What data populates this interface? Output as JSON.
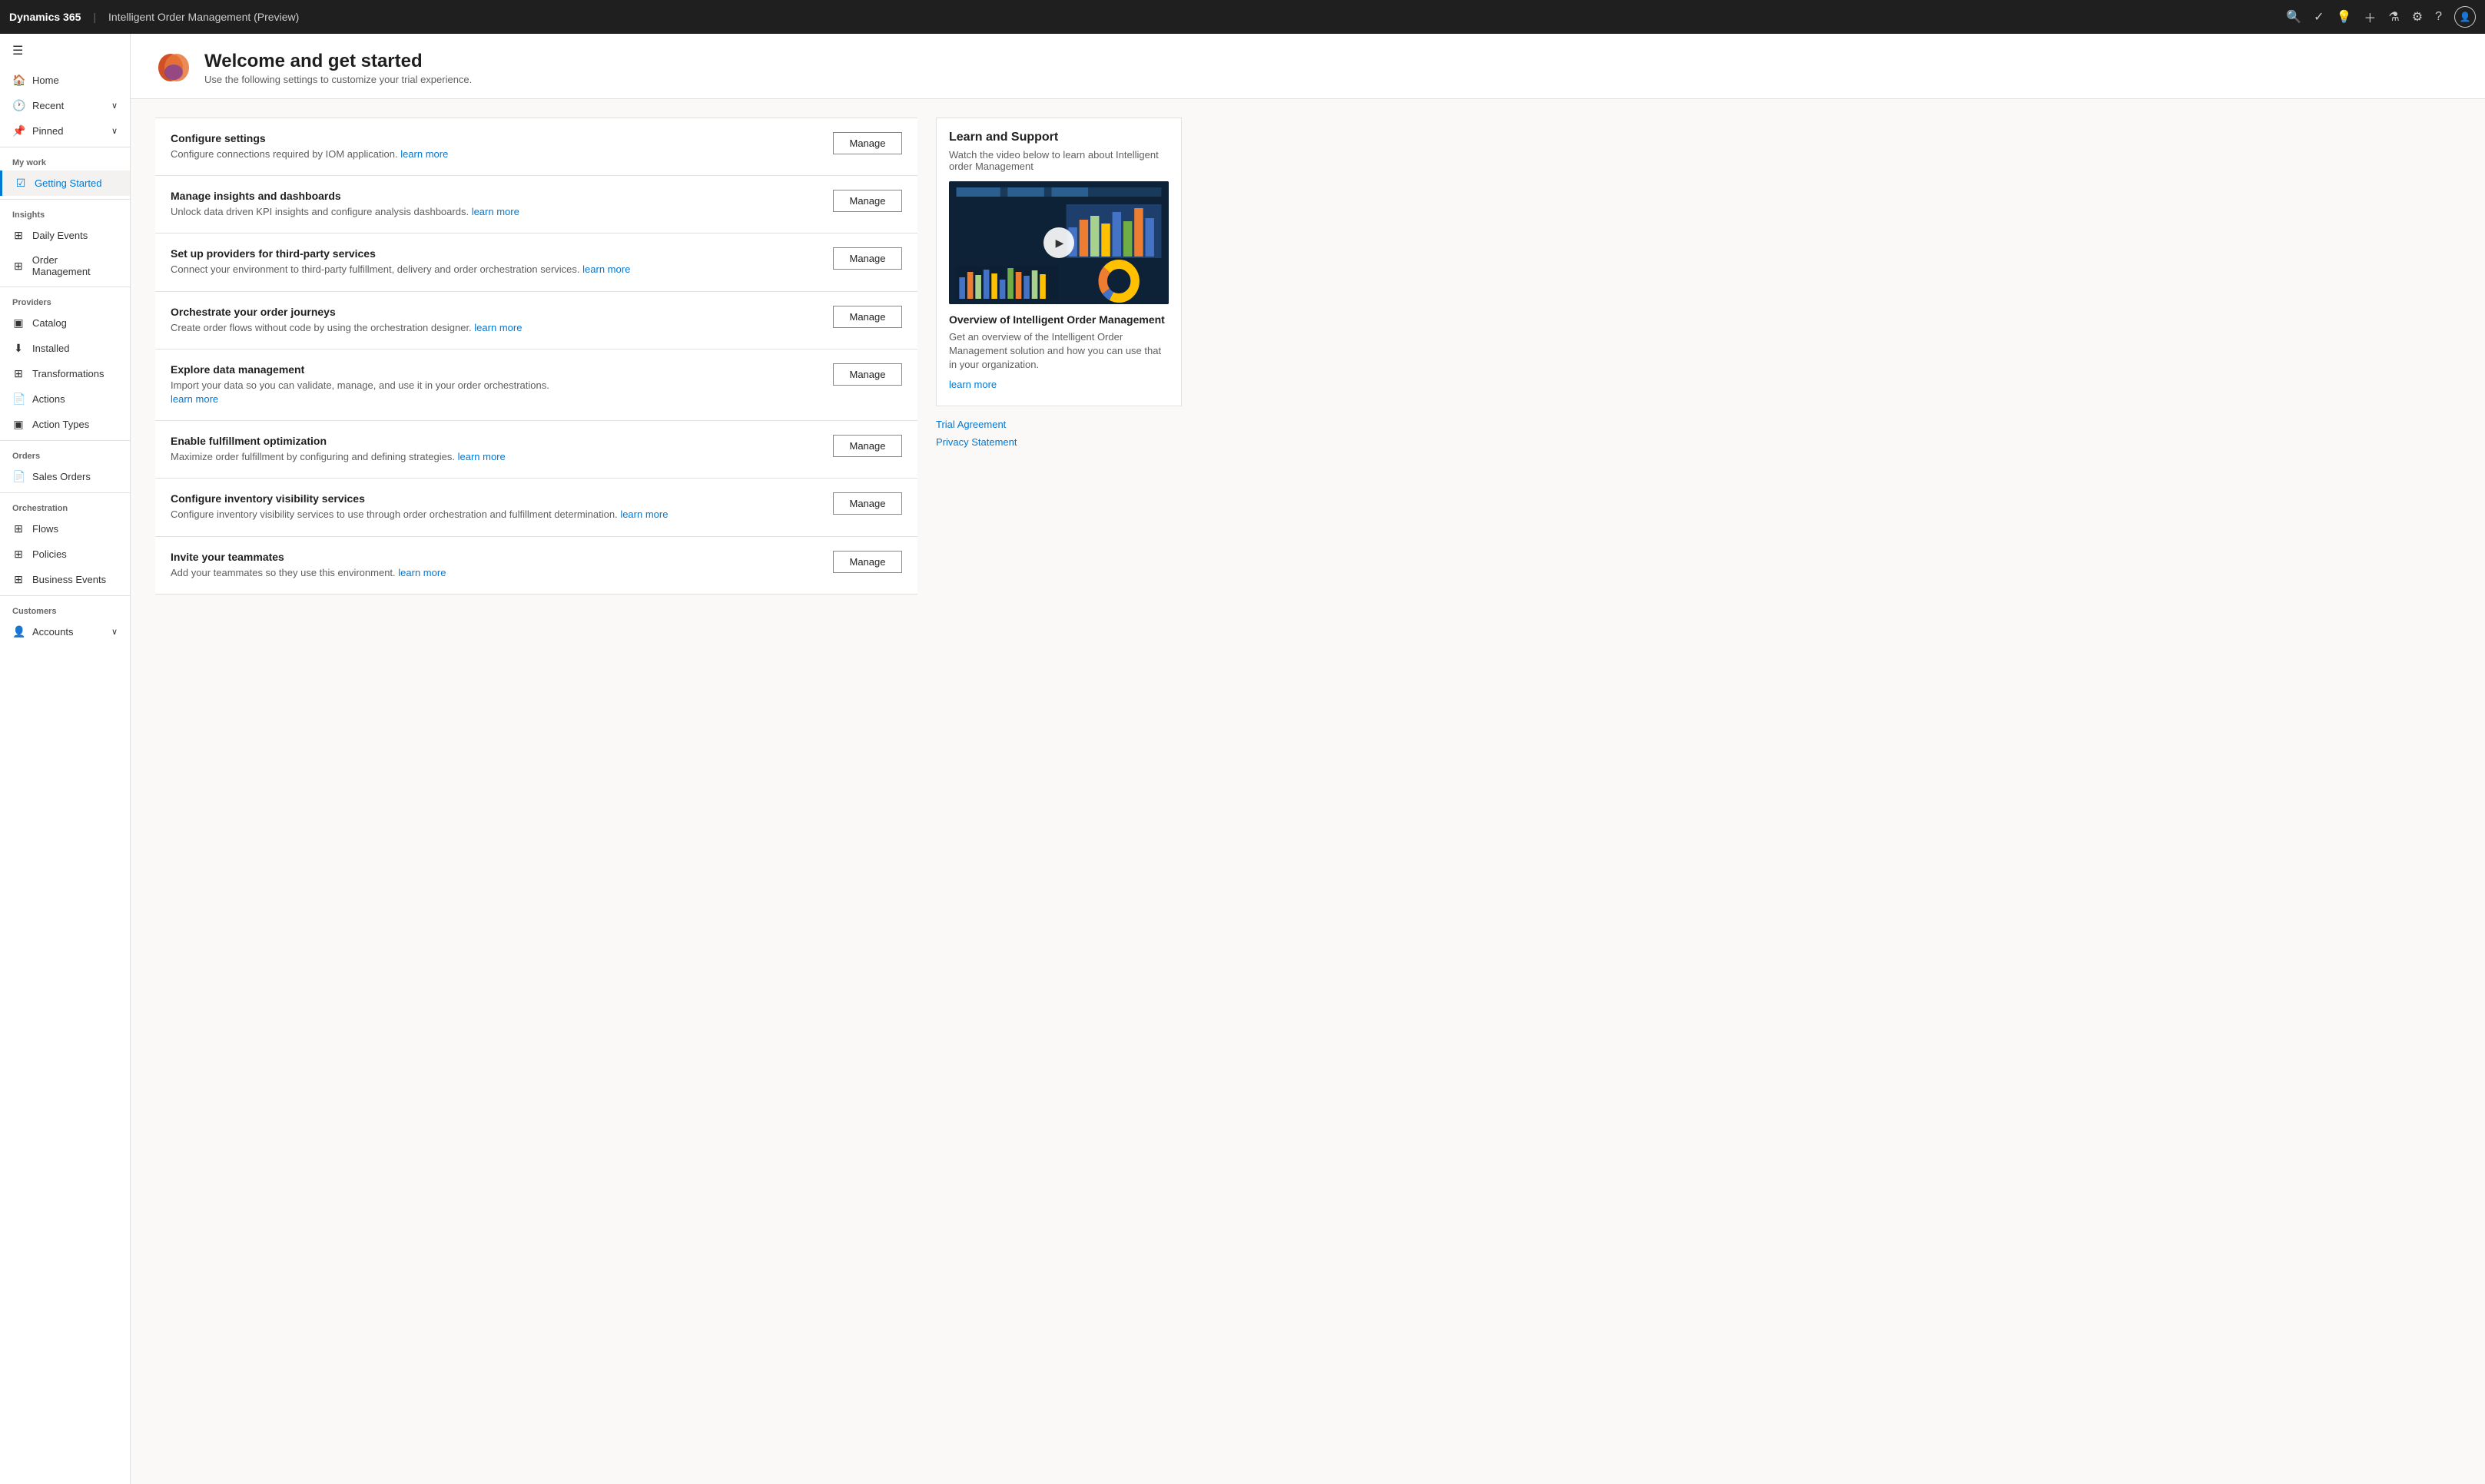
{
  "topbar": {
    "brand": "Dynamics 365",
    "divider": "|",
    "app_name": "Intelligent Order Management (Preview)"
  },
  "sidebar": {
    "hamburger_icon": "☰",
    "nav_items": [
      {
        "id": "home",
        "label": "Home",
        "icon": "🏠",
        "has_chevron": false
      },
      {
        "id": "recent",
        "label": "Recent",
        "icon": "🕐",
        "has_chevron": true
      },
      {
        "id": "pinned",
        "label": "Pinned",
        "icon": "📌",
        "has_chevron": true
      }
    ],
    "sections": [
      {
        "label": "My work",
        "items": [
          {
            "id": "getting-started",
            "label": "Getting Started",
            "icon": "☑",
            "active": true
          }
        ]
      },
      {
        "label": "Insights",
        "items": [
          {
            "id": "daily-events",
            "label": "Daily Events",
            "icon": "⊞"
          },
          {
            "id": "order-management",
            "label": "Order Management",
            "icon": "⊞"
          }
        ]
      },
      {
        "label": "Providers",
        "items": [
          {
            "id": "catalog",
            "label": "Catalog",
            "icon": "▣"
          },
          {
            "id": "installed",
            "label": "Installed",
            "icon": "⬇"
          },
          {
            "id": "transformations",
            "label": "Transformations",
            "icon": "⊞"
          },
          {
            "id": "actions",
            "label": "Actions",
            "icon": "📄"
          },
          {
            "id": "action-types",
            "label": "Action Types",
            "icon": "▣"
          }
        ]
      },
      {
        "label": "Orders",
        "items": [
          {
            "id": "sales-orders",
            "label": "Sales Orders",
            "icon": "📄"
          }
        ]
      },
      {
        "label": "Orchestration",
        "items": [
          {
            "id": "flows",
            "label": "Flows",
            "icon": "⊞"
          },
          {
            "id": "policies",
            "label": "Policies",
            "icon": "⊞"
          },
          {
            "id": "business-events",
            "label": "Business Events",
            "icon": "⊞"
          }
        ]
      },
      {
        "label": "Customers",
        "items": [
          {
            "id": "accounts",
            "label": "Accounts",
            "icon": "👤"
          }
        ]
      }
    ]
  },
  "page": {
    "logo_colors": [
      "#d14f26",
      "#e8763a",
      "#7b3b9e"
    ],
    "title": "Welcome and get started",
    "subtitle": "Use the following settings to customize your trial experience."
  },
  "cards": [
    {
      "id": "configure-settings",
      "title": "Configure settings",
      "desc": "Configure connections required by IOM application.",
      "link_text": "learn more",
      "btn_label": "Manage"
    },
    {
      "id": "manage-insights",
      "title": "Manage insights and dashboards",
      "desc": "Unlock data driven KPI insights and configure analysis dashboards.",
      "link_text": "learn more",
      "btn_label": "Manage"
    },
    {
      "id": "setup-providers",
      "title": "Set up providers for third-party services",
      "desc": "Connect your environment to third-party fulfillment, delivery and order orchestration services.",
      "link_text": "learn more",
      "btn_label": "Manage"
    },
    {
      "id": "orchestrate-journeys",
      "title": "Orchestrate your order journeys",
      "desc": "Create order flows without code by using the orchestration designer.",
      "link_text": "learn more",
      "btn_label": "Manage"
    },
    {
      "id": "explore-data",
      "title": "Explore data management",
      "desc": "Import your data so you can validate, manage, and use it in your order orchestrations.",
      "link_text": "learn more",
      "btn_label": "Manage"
    },
    {
      "id": "fulfillment-optimization",
      "title": "Enable fulfillment optimization",
      "desc": "Maximize order fulfillment by configuring and defining strategies.",
      "link_text": "learn more",
      "btn_label": "Manage"
    },
    {
      "id": "inventory-visibility",
      "title": "Configure inventory visibility services",
      "desc": "Configure inventory visibility services to use through order orchestration and fulfillment determination.",
      "link_text": "learn more",
      "btn_label": "Manage"
    },
    {
      "id": "invite-teammates",
      "title": "Invite your teammates",
      "desc": "Add your teammates so they use this environment.",
      "link_text": "learn more",
      "btn_label": "Manage"
    }
  ],
  "learn_support": {
    "title": "Learn and Support",
    "desc": "Watch the video below to learn about Intelligent order Management",
    "video_title": "Overview of Intelligent Order Management",
    "video_desc": "Get an overview of the Intelligent Order Management solution and how you can use that in your organization.",
    "video_learn_more": "learn more",
    "external_links": [
      {
        "id": "trial-agreement",
        "label": "Trial Agreement"
      },
      {
        "id": "privacy-statement",
        "label": "Privacy Statement"
      }
    ]
  }
}
